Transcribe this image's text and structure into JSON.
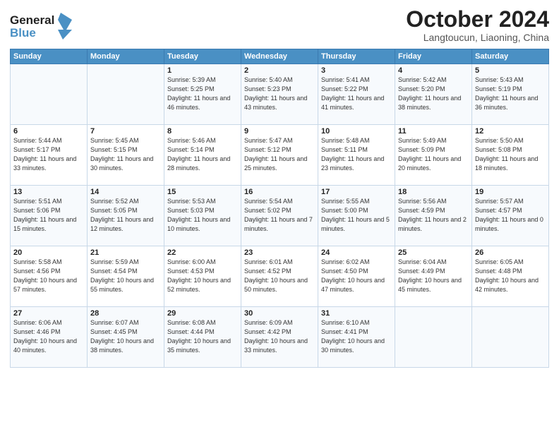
{
  "header": {
    "logo_line1": "General",
    "logo_line2": "Blue",
    "month": "October 2024",
    "location": "Langtoucun, Liaoning, China"
  },
  "days_of_week": [
    "Sunday",
    "Monday",
    "Tuesday",
    "Wednesday",
    "Thursday",
    "Friday",
    "Saturday"
  ],
  "weeks": [
    [
      {
        "day": "",
        "info": ""
      },
      {
        "day": "",
        "info": ""
      },
      {
        "day": "1",
        "info": "Sunrise: 5:39 AM\nSunset: 5:25 PM\nDaylight: 11 hours and 46 minutes."
      },
      {
        "day": "2",
        "info": "Sunrise: 5:40 AM\nSunset: 5:23 PM\nDaylight: 11 hours and 43 minutes."
      },
      {
        "day": "3",
        "info": "Sunrise: 5:41 AM\nSunset: 5:22 PM\nDaylight: 11 hours and 41 minutes."
      },
      {
        "day": "4",
        "info": "Sunrise: 5:42 AM\nSunset: 5:20 PM\nDaylight: 11 hours and 38 minutes."
      },
      {
        "day": "5",
        "info": "Sunrise: 5:43 AM\nSunset: 5:19 PM\nDaylight: 11 hours and 36 minutes."
      }
    ],
    [
      {
        "day": "6",
        "info": "Sunrise: 5:44 AM\nSunset: 5:17 PM\nDaylight: 11 hours and 33 minutes."
      },
      {
        "day": "7",
        "info": "Sunrise: 5:45 AM\nSunset: 5:15 PM\nDaylight: 11 hours and 30 minutes."
      },
      {
        "day": "8",
        "info": "Sunrise: 5:46 AM\nSunset: 5:14 PM\nDaylight: 11 hours and 28 minutes."
      },
      {
        "day": "9",
        "info": "Sunrise: 5:47 AM\nSunset: 5:12 PM\nDaylight: 11 hours and 25 minutes."
      },
      {
        "day": "10",
        "info": "Sunrise: 5:48 AM\nSunset: 5:11 PM\nDaylight: 11 hours and 23 minutes."
      },
      {
        "day": "11",
        "info": "Sunrise: 5:49 AM\nSunset: 5:09 PM\nDaylight: 11 hours and 20 minutes."
      },
      {
        "day": "12",
        "info": "Sunrise: 5:50 AM\nSunset: 5:08 PM\nDaylight: 11 hours and 18 minutes."
      }
    ],
    [
      {
        "day": "13",
        "info": "Sunrise: 5:51 AM\nSunset: 5:06 PM\nDaylight: 11 hours and 15 minutes."
      },
      {
        "day": "14",
        "info": "Sunrise: 5:52 AM\nSunset: 5:05 PM\nDaylight: 11 hours and 12 minutes."
      },
      {
        "day": "15",
        "info": "Sunrise: 5:53 AM\nSunset: 5:03 PM\nDaylight: 11 hours and 10 minutes."
      },
      {
        "day": "16",
        "info": "Sunrise: 5:54 AM\nSunset: 5:02 PM\nDaylight: 11 hours and 7 minutes."
      },
      {
        "day": "17",
        "info": "Sunrise: 5:55 AM\nSunset: 5:00 PM\nDaylight: 11 hours and 5 minutes."
      },
      {
        "day": "18",
        "info": "Sunrise: 5:56 AM\nSunset: 4:59 PM\nDaylight: 11 hours and 2 minutes."
      },
      {
        "day": "19",
        "info": "Sunrise: 5:57 AM\nSunset: 4:57 PM\nDaylight: 11 hours and 0 minutes."
      }
    ],
    [
      {
        "day": "20",
        "info": "Sunrise: 5:58 AM\nSunset: 4:56 PM\nDaylight: 10 hours and 57 minutes."
      },
      {
        "day": "21",
        "info": "Sunrise: 5:59 AM\nSunset: 4:54 PM\nDaylight: 10 hours and 55 minutes."
      },
      {
        "day": "22",
        "info": "Sunrise: 6:00 AM\nSunset: 4:53 PM\nDaylight: 10 hours and 52 minutes."
      },
      {
        "day": "23",
        "info": "Sunrise: 6:01 AM\nSunset: 4:52 PM\nDaylight: 10 hours and 50 minutes."
      },
      {
        "day": "24",
        "info": "Sunrise: 6:02 AM\nSunset: 4:50 PM\nDaylight: 10 hours and 47 minutes."
      },
      {
        "day": "25",
        "info": "Sunrise: 6:04 AM\nSunset: 4:49 PM\nDaylight: 10 hours and 45 minutes."
      },
      {
        "day": "26",
        "info": "Sunrise: 6:05 AM\nSunset: 4:48 PM\nDaylight: 10 hours and 42 minutes."
      }
    ],
    [
      {
        "day": "27",
        "info": "Sunrise: 6:06 AM\nSunset: 4:46 PM\nDaylight: 10 hours and 40 minutes."
      },
      {
        "day": "28",
        "info": "Sunrise: 6:07 AM\nSunset: 4:45 PM\nDaylight: 10 hours and 38 minutes."
      },
      {
        "day": "29",
        "info": "Sunrise: 6:08 AM\nSunset: 4:44 PM\nDaylight: 10 hours and 35 minutes."
      },
      {
        "day": "30",
        "info": "Sunrise: 6:09 AM\nSunset: 4:42 PM\nDaylight: 10 hours and 33 minutes."
      },
      {
        "day": "31",
        "info": "Sunrise: 6:10 AM\nSunset: 4:41 PM\nDaylight: 10 hours and 30 minutes."
      },
      {
        "day": "",
        "info": ""
      },
      {
        "day": "",
        "info": ""
      }
    ]
  ]
}
